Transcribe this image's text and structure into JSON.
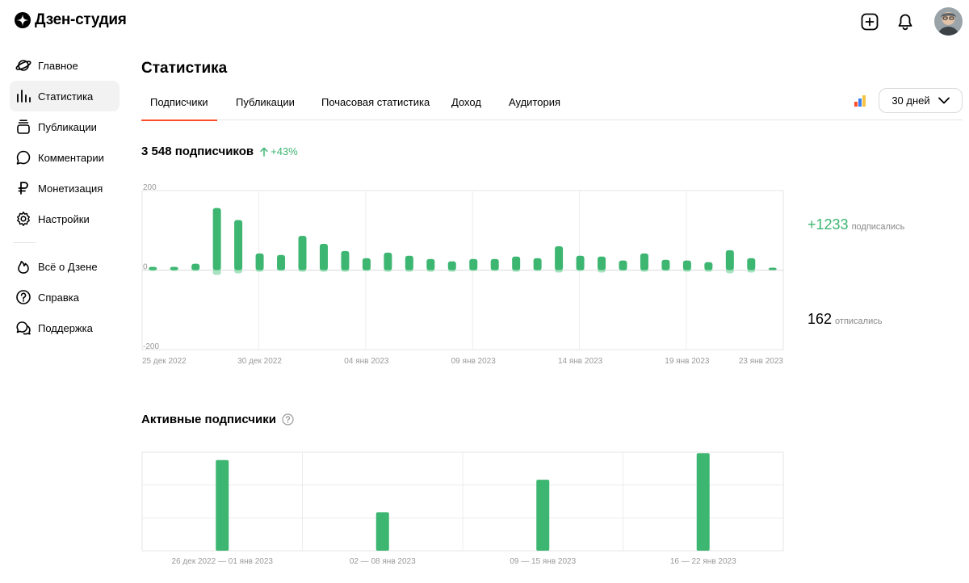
{
  "app": {
    "logo_text": "Дзен-студия"
  },
  "sidebar": {
    "items": [
      {
        "label": "Главное",
        "icon": "planet-icon"
      },
      {
        "label": "Статистика",
        "icon": "stats-bars-icon"
      },
      {
        "label": "Публикации",
        "icon": "publications-stack-icon"
      },
      {
        "label": "Комментарии",
        "icon": "comment-bubble-icon"
      },
      {
        "label": "Монетизация",
        "icon": "ruble-icon"
      },
      {
        "label": "Настройки",
        "icon": "gear-icon"
      }
    ],
    "secondary": [
      {
        "label": "Всё о Дзене",
        "icon": "flame-icon"
      },
      {
        "label": "Справка",
        "icon": "question-circle-icon"
      },
      {
        "label": "Поддержка",
        "icon": "support-chat-icon"
      }
    ]
  },
  "main": {
    "title": "Статистика",
    "tabs": [
      {
        "label": "Подписчики",
        "active": true
      },
      {
        "label": "Публикации",
        "active": false
      },
      {
        "label": "Почасовая статистика",
        "active": false
      },
      {
        "label": "Доход",
        "active": false
      },
      {
        "label": "Аудитория",
        "active": false
      }
    ],
    "period": "30 дней",
    "subscribers_total": "3 548 подписчиков",
    "growth": "+43%",
    "stats": {
      "subscribed_value": "+1233",
      "subscribed_label": "подписались",
      "unsubscribed_value": "162",
      "unsubscribed_label": "отписались"
    },
    "active_title": "Активные подписчики"
  },
  "colors": {
    "accent_green": "#3db672",
    "light_green": "#a8e2bf",
    "tab_underline": "#ff4e2a"
  },
  "chart_data": [
    {
      "type": "bar",
      "ylim": [
        -200,
        200
      ],
      "y_ticks": [
        "200",
        "0",
        "-200"
      ],
      "x_tick_labels": [
        "25 дек 2022",
        "30 дек 2022",
        "04 янв 2023",
        "09 янв 2023",
        "14 янв 2023",
        "19 янв 2023",
        "23 янв 2023"
      ],
      "series": [
        {
          "values": [
            8,
            8,
            16,
            156,
            126,
            42,
            38,
            86,
            66,
            48,
            30,
            44,
            36,
            28,
            22,
            28,
            28,
            34,
            30,
            60,
            36,
            34,
            24,
            42,
            26,
            24,
            20,
            50,
            30,
            6
          ]
        },
        {
          "values": [
            -2,
            -2,
            -2,
            -12,
            -8,
            -4,
            -2,
            -4,
            -4,
            -4,
            -2,
            -4,
            -4,
            -4,
            -4,
            -2,
            -2,
            -4,
            -2,
            -6,
            -2,
            -6,
            -2,
            -4,
            -2,
            -4,
            -4,
            -8,
            -6,
            0
          ]
        }
      ]
    },
    {
      "type": "bar",
      "categories": [
        "26 дек 2022 — 01 янв 2023",
        "02 — 08 янв 2023",
        "09 — 15 янв 2023",
        "16 — 22 янв 2023"
      ],
      "values": [
        92,
        39,
        72,
        99
      ]
    }
  ]
}
